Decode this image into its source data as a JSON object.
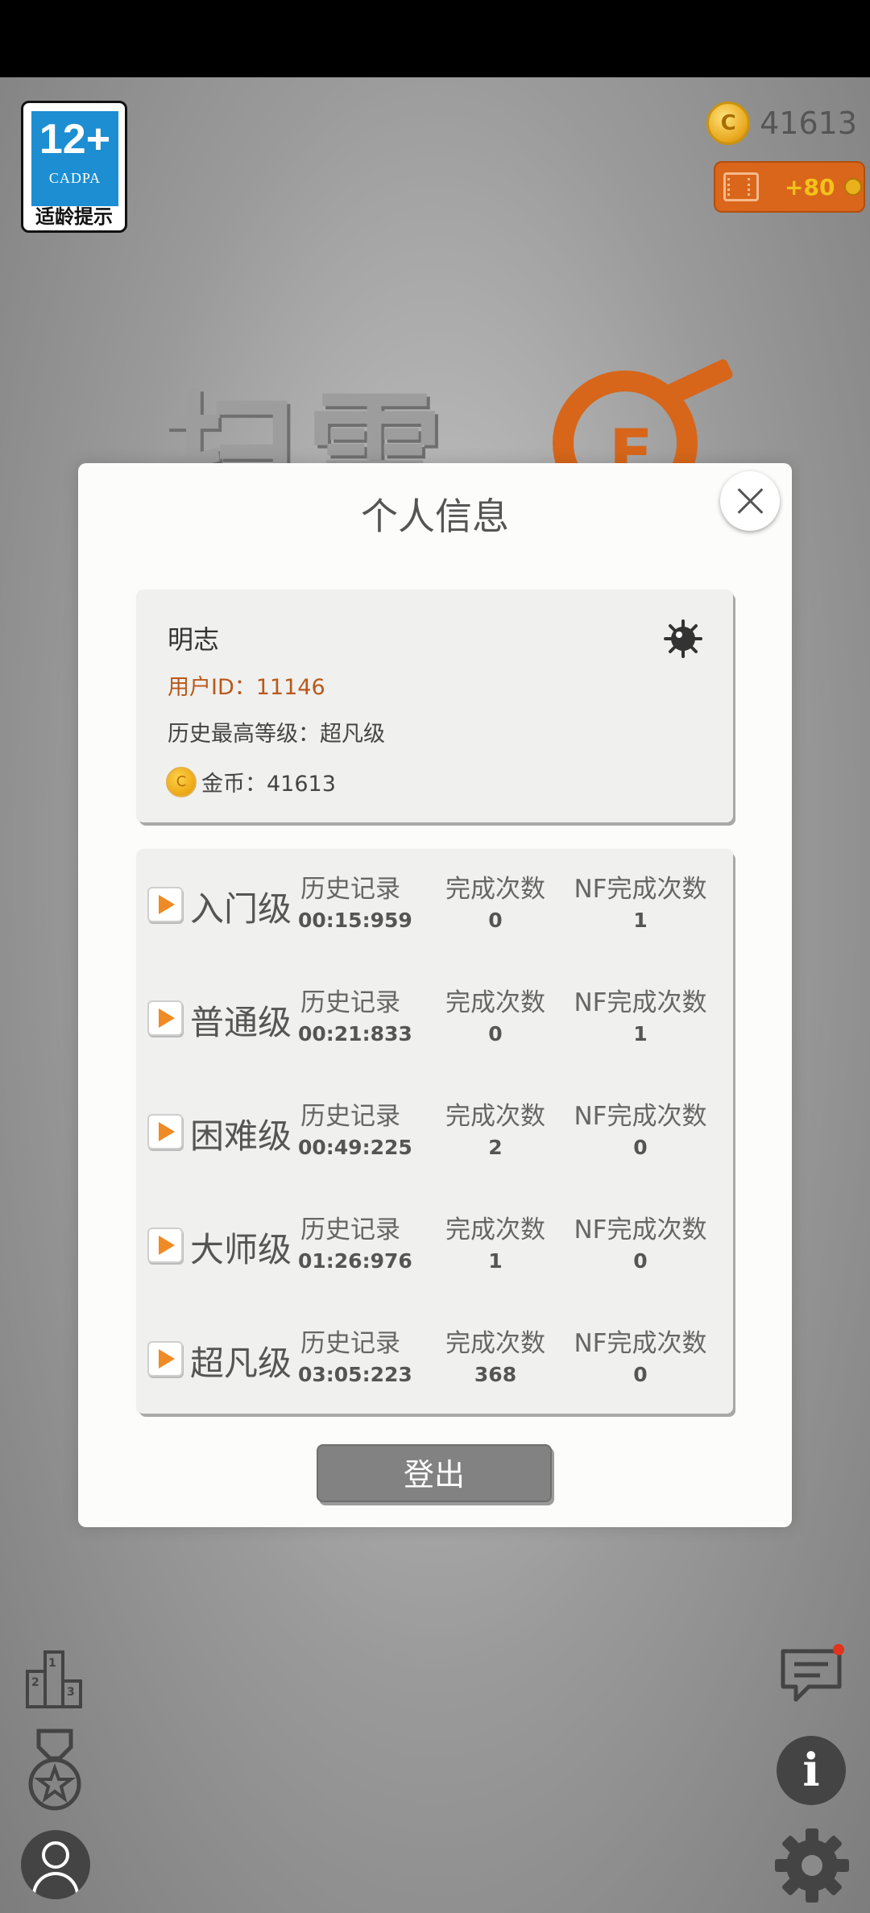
{
  "age_rating": {
    "number": "12+",
    "org": "CADPA",
    "label": "适龄提示"
  },
  "top": {
    "coin_amount": "41613",
    "video_reward": "+80",
    "coin_letter": "C"
  },
  "logo": {
    "title": "扫雷",
    "letter": "E"
  },
  "dialog": {
    "title": "个人信息",
    "user": {
      "name": "明志",
      "id_label": "用户ID：11146",
      "highest_level": "历史最高等级：超凡级",
      "gold": "金币：41613",
      "coin_letter": "C"
    },
    "columns": {
      "record": "历史记录",
      "completed": "完成次数",
      "nf_completed": "NF完成次数"
    },
    "levels": [
      {
        "name": "入门级",
        "record": "00:15:959",
        "completed": "0",
        "nf": "1"
      },
      {
        "name": "普通级",
        "record": "00:21:833",
        "completed": "0",
        "nf": "1"
      },
      {
        "name": "困难级",
        "record": "00:49:225",
        "completed": "2",
        "nf": "0"
      },
      {
        "name": "大师级",
        "record": "01:26:976",
        "completed": "1",
        "nf": "0"
      },
      {
        "name": "超凡级",
        "record": "03:05:223",
        "completed": "368",
        "nf": "0"
      }
    ],
    "logout_label": "登出"
  },
  "bottom": {
    "info_symbol": "i"
  },
  "colors": {
    "accent_orange": "#d9661a",
    "uid_orange": "#b9581a",
    "play_orange": "#f08a24",
    "logout_gray": "#828282"
  }
}
